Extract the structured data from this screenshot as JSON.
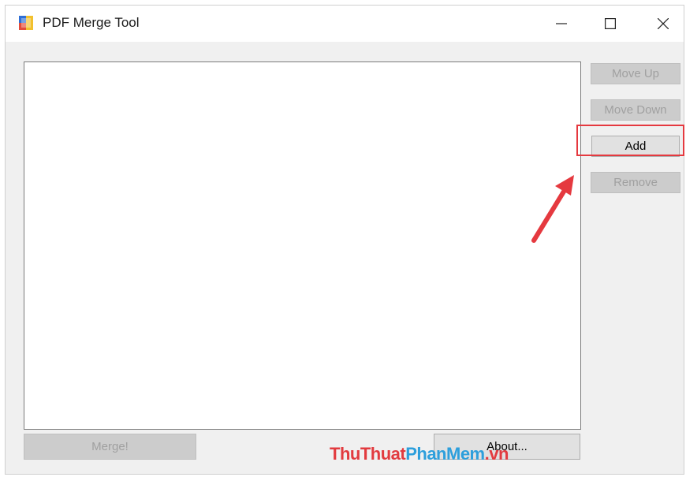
{
  "window": {
    "title": "PDF Merge Tool",
    "controls": {
      "minimize": "—",
      "maximize": "☐",
      "close": "✕"
    }
  },
  "buttons": {
    "move_up": "Move Up",
    "move_down": "Move Down",
    "add": "Add",
    "remove": "Remove",
    "merge": "Merge!",
    "about": "About..."
  },
  "watermark": {
    "part1": "ThuThuat",
    "part2": "PhanMem",
    "part3": ".vn"
  },
  "colors": {
    "highlight": "#e5393f",
    "watermark_red": "#e23b3f",
    "watermark_blue": "#2d9fdc"
  }
}
